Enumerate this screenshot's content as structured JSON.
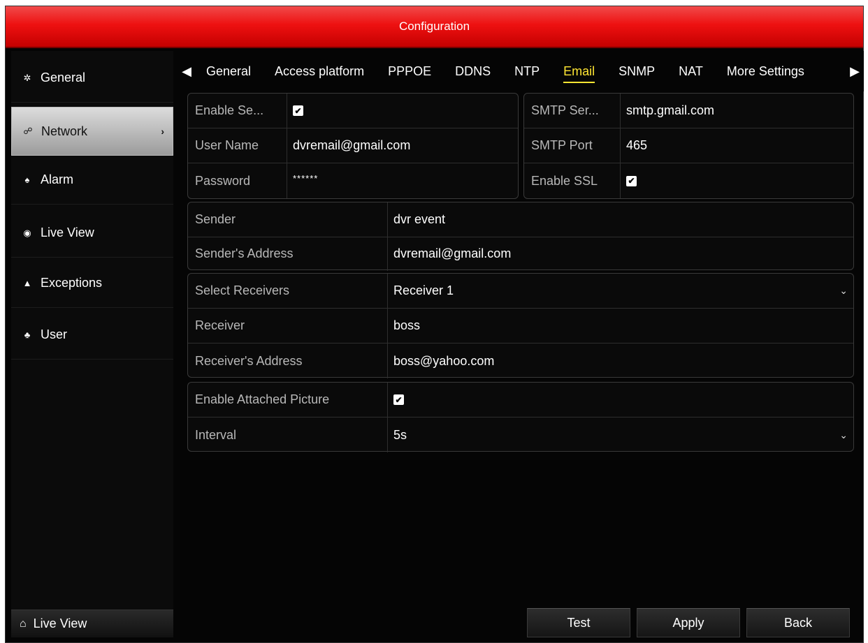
{
  "window": {
    "title": "Configuration"
  },
  "sidebar": {
    "items": [
      {
        "label": "General",
        "icon": "gear-icon"
      },
      {
        "label": "Network",
        "icon": "network-icon",
        "arrow": "›"
      },
      {
        "label": "Alarm",
        "icon": "bell-icon"
      },
      {
        "label": "Live View",
        "icon": "eye-icon"
      },
      {
        "label": "Exceptions",
        "icon": "warning-icon"
      },
      {
        "label": "User",
        "icon": "users-icon"
      }
    ],
    "bottom": {
      "label": "Live View",
      "icon": "home-icon"
    }
  },
  "tabs": {
    "items": [
      "General",
      "Access platform",
      "PPPOE",
      "DDNS",
      "NTP",
      "Email",
      "SNMP",
      "NAT",
      "More Settings"
    ],
    "active": "Email",
    "left_arrow": "◀",
    "right_arrow": "▶"
  },
  "server": {
    "enable_auth_label": "Enable Se...",
    "enable_auth_checked": true,
    "username_label": "User Name",
    "username_value": "dvremail@gmail.com",
    "password_label": "Password",
    "password_value": "******",
    "smtp_server_label": "SMTP Ser...",
    "smtp_server_value": "smtp.gmail.com",
    "smtp_port_label": "SMTP Port",
    "smtp_port_value": "465",
    "ssl_label": "Enable SSL",
    "ssl_checked": true
  },
  "sender": {
    "sender_label": "Sender",
    "sender_value": "dvr event",
    "address_label": "Sender's Address",
    "address_value": "dvremail@gmail.com"
  },
  "receiver": {
    "select_label": "Select Receivers",
    "select_value": "Receiver 1",
    "receiver_label": "Receiver",
    "receiver_value": "boss",
    "address_label": "Receiver's Address",
    "address_value": "boss@yahoo.com"
  },
  "attachment": {
    "enable_label": "Enable Attached Picture",
    "enable_checked": true,
    "interval_label": "Interval",
    "interval_value": "5s"
  },
  "buttons": {
    "test": "Test",
    "apply": "Apply",
    "back": "Back"
  },
  "glyphs": {
    "check": "✔",
    "chevron": "⌄"
  },
  "colors": {
    "title_red": "#e11111",
    "active_tab": "#ffe633"
  }
}
